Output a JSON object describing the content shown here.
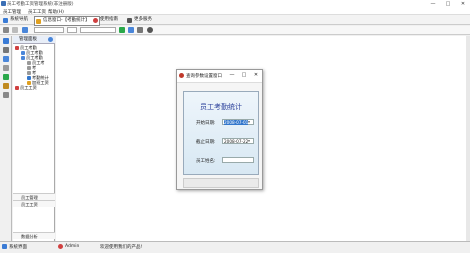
{
  "window": {
    "title": "员工考勤工资管理系统(非注册版)",
    "controls": [
      "—",
      "□",
      "✕"
    ]
  },
  "menu": [
    "员工管理",
    "员工工资",
    "帮助(H)"
  ],
  "tabs": [
    {
      "label": "系统导航",
      "icon": "home-icon"
    },
    {
      "label": "信息窗口-【考勤统计】",
      "icon": "info-icon",
      "active": true
    },
    {
      "label": "使用指南",
      "icon": "guide-icon"
    },
    {
      "label": "更多服务",
      "icon": "service-icon"
    }
  ],
  "toolbar": {
    "combo_value": ""
  },
  "tree": {
    "header": "管理面板",
    "nodes": [
      {
        "label": "员工考勤",
        "level": 1
      },
      {
        "label": "员工考勤",
        "level": 2
      },
      {
        "label": "员工考勤",
        "level": 2
      },
      {
        "label": "员工考",
        "level": 3
      },
      {
        "label": "考",
        "level": 3
      },
      {
        "label": "考",
        "level": 3
      },
      {
        "label": "考勤统计",
        "level": 3
      },
      {
        "label": "加班工资",
        "level": 3
      },
      {
        "label": "员工工资",
        "level": 1
      }
    ],
    "bottom": [
      "员工管理",
      "员工工资",
      "数据分析"
    ]
  },
  "status": {
    "label1": "系统界面",
    "user": "Admin",
    "message": "欢迎使用我们的产品!"
  },
  "dialog": {
    "title": "查询参数设置窗口",
    "heading": "员工考勤统计",
    "start_label": "开始日期:",
    "start_value": "2008-07-01",
    "end_label": "截止日期:",
    "end_value": "2008-07-22",
    "name_label": "员工姓名:",
    "name_value": ""
  },
  "colors": {
    "accent": "#3377cc",
    "heading": "#2a3f9a"
  }
}
